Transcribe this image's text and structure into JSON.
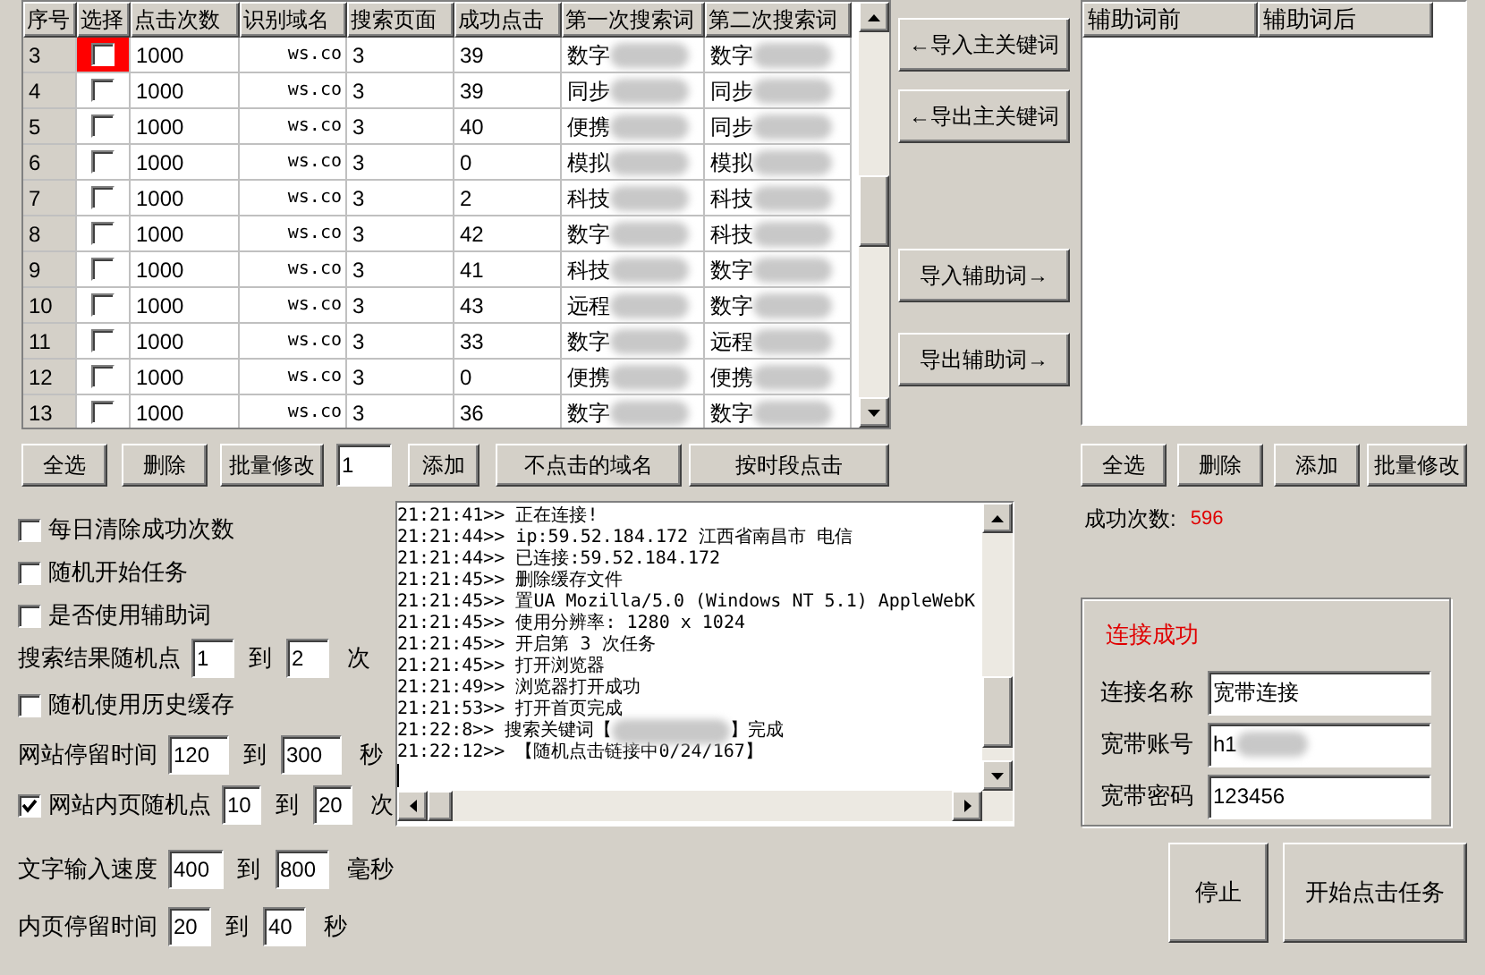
{
  "table": {
    "columns": [
      "序号",
      "选择",
      "点击次数",
      "识别域名",
      "搜索页面",
      "成功点击",
      "第一次搜索词",
      "第二次搜索词"
    ],
    "rows": [
      {
        "index": "3",
        "selected": true,
        "checked": false,
        "clicks": "1000",
        "domain": "ws.co",
        "page": "3",
        "success": "39",
        "first": "数字",
        "second": "数字"
      },
      {
        "index": "4",
        "selected": false,
        "checked": false,
        "clicks": "1000",
        "domain": "ws.co",
        "page": "3",
        "success": "39",
        "first": "同步",
        "second": "同步"
      },
      {
        "index": "5",
        "selected": false,
        "checked": false,
        "clicks": "1000",
        "domain": "ws.co",
        "page": "3",
        "success": "40",
        "first": "便携",
        "second": "同步"
      },
      {
        "index": "6",
        "selected": false,
        "checked": false,
        "clicks": "1000",
        "domain": "ws.co",
        "page": "3",
        "success": "0",
        "first": "模拟",
        "second": "模拟"
      },
      {
        "index": "7",
        "selected": false,
        "checked": false,
        "clicks": "1000",
        "domain": "ws.co",
        "page": "3",
        "success": "2",
        "first": "科技",
        "second": "科技"
      },
      {
        "index": "8",
        "selected": false,
        "checked": false,
        "clicks": "1000",
        "domain": "ws.co",
        "page": "3",
        "success": "42",
        "first": "数字",
        "second": "科技"
      },
      {
        "index": "9",
        "selected": false,
        "checked": false,
        "clicks": "1000",
        "domain": "ws.co",
        "page": "3",
        "success": "41",
        "first": "科技",
        "second": "数字"
      },
      {
        "index": "10",
        "selected": false,
        "checked": false,
        "clicks": "1000",
        "domain": "ws.co",
        "page": "3",
        "success": "43",
        "first": "远程",
        "second": "数字"
      },
      {
        "index": "11",
        "selected": false,
        "checked": false,
        "clicks": "1000",
        "domain": "ws.co",
        "page": "3",
        "success": "33",
        "first": "数字",
        "second": "远程"
      },
      {
        "index": "12",
        "selected": false,
        "checked": false,
        "clicks": "1000",
        "domain": "ws.co",
        "page": "3",
        "success": "0",
        "first": "便携",
        "second": "便携"
      },
      {
        "index": "13",
        "selected": false,
        "checked": false,
        "clicks": "1000",
        "domain": "ws.co",
        "page": "3",
        "success": "36",
        "first": "数字",
        "second": "数字"
      }
    ]
  },
  "side_buttons": [
    "←导入主关键词",
    "←导出主关键词",
    "导入辅助词→",
    "导出辅助词→"
  ],
  "aux_list": {
    "columns": [
      "辅助词前",
      "辅助词后"
    ]
  },
  "table_toolbar": {
    "buttons_before": [
      "全选",
      "删除",
      "批量修改"
    ],
    "count_value": "1",
    "buttons_after": [
      "添加",
      "不点击的域名",
      "按时段点击"
    ]
  },
  "aux_toolbar": [
    "全选",
    "删除",
    "添加",
    "批量修改"
  ],
  "options": [
    {
      "kind": "check",
      "label": "每日清除成功次数",
      "checked": false
    },
    {
      "kind": "check",
      "label": "随机开始任务",
      "checked": false
    },
    {
      "kind": "check",
      "label": "是否使用辅助词",
      "checked": false
    },
    {
      "kind": "range",
      "label": "搜索结果随机点",
      "from": "1",
      "to_label": "到",
      "to": "2",
      "unit": "次"
    },
    {
      "kind": "check",
      "label": "随机使用历史缓存",
      "checked": false
    },
    {
      "kind": "range",
      "label": "网站停留时间",
      "from": "120",
      "to_label": "到",
      "to": "300",
      "unit": "秒"
    },
    {
      "kind": "checkrange",
      "label": "网站内页随机点",
      "checked": true,
      "from": "10",
      "to_label": "到",
      "to": "20",
      "unit": "次"
    },
    {
      "kind": "range",
      "label": "文字输入速度",
      "from": "400",
      "to_label": "到",
      "to": "800",
      "unit": "毫秒"
    },
    {
      "kind": "range",
      "label": "内页停留时间",
      "from": "20",
      "to_label": "到",
      "to": "40",
      "unit": "秒"
    }
  ],
  "log": [
    {
      "text": "21:21:41>> 正在连接!"
    },
    {
      "text": "21:21:44>> ip:59.52.184.172  江西省南昌市 电信"
    },
    {
      "text": "21:21:44>> 已连接:59.52.184.172"
    },
    {
      "text": "21:21:45>> 删除缓存文件"
    },
    {
      "text": "21:21:45>> 置UA Mozilla/5.0 (Windows NT 5.1) AppleWebK"
    },
    {
      "text": "21:21:45>> 使用分辨率: 1280 x 1024"
    },
    {
      "text": "21:21:45>> 开启第 3 次任务"
    },
    {
      "text": "21:21:45>> 打开浏览器"
    },
    {
      "text": "21:21:49>> 浏览器打开成功"
    },
    {
      "text": "21:21:53>> 打开首页完成"
    },
    {
      "text": "21:22:8>> 搜索关键词【",
      "after_mask": "】完成"
    },
    {
      "text": "21:22:12>> 【随机点击链接中0/24/167】"
    }
  ],
  "success_count": {
    "label": "成功次数:",
    "value": "596"
  },
  "connection": {
    "status": "连接成功",
    "fields": [
      {
        "label": "连接名称",
        "value": "宽带连接"
      },
      {
        "label": "宽带账号",
        "value": "h1",
        "masked": true
      },
      {
        "label": "宽带密码",
        "value": "123456"
      }
    ]
  },
  "action_buttons": [
    "停止",
    "开始点击任务"
  ]
}
